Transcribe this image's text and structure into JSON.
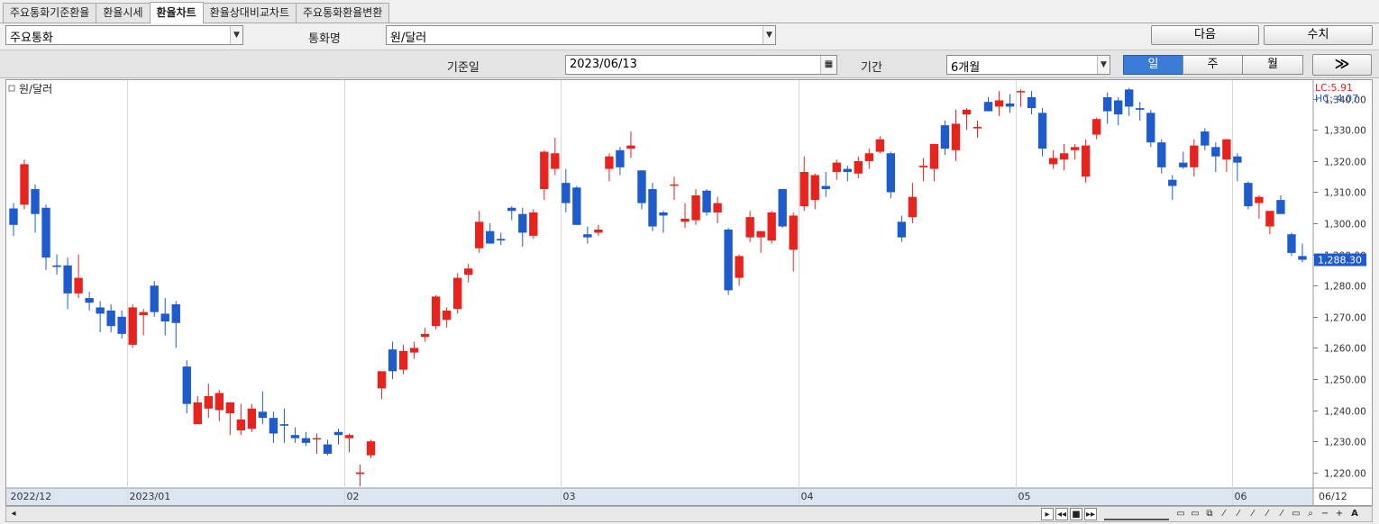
{
  "tabs": [
    {
      "label": "주요통화기준환율",
      "active": false
    },
    {
      "label": "환율시세",
      "active": false
    },
    {
      "label": "환율차트",
      "active": true
    },
    {
      "label": "환율상대비교차트",
      "active": false
    },
    {
      "label": "주요통화환율변환",
      "active": false
    }
  ],
  "controls": {
    "currency_group": "주요통화",
    "currency_name_label": "통화명",
    "currency_name": "원/달러",
    "next_label": "다음",
    "value_label": "수치",
    "base_date_label": "기준일",
    "base_date": "2023/06/13",
    "period_label": "기간",
    "period": "6개월",
    "interval_day": "일",
    "interval_week": "주",
    "interval_month": "월",
    "interval_selected": "일",
    "forward_glyph": "≫"
  },
  "colors": {
    "up": "#e8231e",
    "down": "#1e5ccd",
    "grid": "#d8d8d8",
    "axis_bg": "#dce6f2",
    "current": "#1e5ccd"
  },
  "chart_data": {
    "type": "candlestick",
    "legend": "원/달러",
    "lc": "LC:5.91",
    "hc": "HC:-4.07",
    "current_price": "1,288.30",
    "ylim": [
      1215,
      1346
    ],
    "y_ticks": [
      {
        "value": 1340,
        "label": "1,340.00"
      },
      {
        "value": 1330,
        "label": "1,330.00"
      },
      {
        "value": 1320,
        "label": "1,320.00"
      },
      {
        "value": 1310,
        "label": "1,310.00"
      },
      {
        "value": 1300,
        "label": "1,300.00"
      },
      {
        "value": 1290,
        "label": "1,290.00"
      },
      {
        "value": 1280,
        "label": "1,280.00"
      },
      {
        "value": 1270,
        "label": "1,270.00"
      },
      {
        "value": 1260,
        "label": "1,260.00"
      },
      {
        "value": 1250,
        "label": "1,250.00"
      },
      {
        "value": 1240,
        "label": "1,240.00"
      },
      {
        "value": 1230,
        "label": "1,230.00"
      },
      {
        "value": 1220,
        "label": "1,220.00"
      }
    ],
    "x_labels": [
      {
        "index": 0,
        "label": "2022/12"
      },
      {
        "index": 11,
        "label": "2023/01"
      },
      {
        "index": 31,
        "label": "02"
      },
      {
        "index": 51,
        "label": "03"
      },
      {
        "index": 73,
        "label": "04"
      },
      {
        "index": 93,
        "label": "05"
      },
      {
        "index": 113,
        "label": "06"
      },
      {
        "index": 120,
        "label": "06/12"
      }
    ],
    "candles": [
      [
        1304.8,
        1306.5,
        1296.0,
        1299.5
      ],
      [
        1306.0,
        1320.5,
        1304.5,
        1319.0
      ],
      [
        1311.0,
        1312.5,
        1297.0,
        1303.0
      ],
      [
        1305.0,
        1306.0,
        1285.0,
        1289.0
      ],
      [
        1286.5,
        1290.0,
        1283.5,
        1286.0
      ],
      [
        1286.5,
        1289.0,
        1272.5,
        1277.5
      ],
      [
        1277.5,
        1290.0,
        1276.0,
        1282.5
      ],
      [
        1276.0,
        1278.0,
        1272.0,
        1274.5
      ],
      [
        1273.0,
        1275.0,
        1265.0,
        1271.0
      ],
      [
        1272.0,
        1274.0,
        1265.0,
        1267.0
      ],
      [
        1270.0,
        1272.0,
        1263.0,
        1264.5
      ],
      [
        1261.0,
        1274.0,
        1260.0,
        1273.0
      ],
      [
        1270.5,
        1272.5,
        1264.0,
        1271.5
      ],
      [
        1280.0,
        1281.5,
        1270.0,
        1271.5
      ],
      [
        1271.0,
        1276.0,
        1264.0,
        1268.5
      ],
      [
        1274.0,
        1275.0,
        1260.0,
        1268.0
      ],
      [
        1254.0,
        1256.0,
        1239.0,
        1242.0
      ],
      [
        1235.5,
        1244.5,
        1235.5,
        1242.5
      ],
      [
        1240.5,
        1248.5,
        1237.5,
        1244.5
      ],
      [
        1240.0,
        1246.5,
        1236.5,
        1245.5
      ],
      [
        1239.0,
        1242.5,
        1232.0,
        1242.5
      ],
      [
        1233.5,
        1242.0,
        1232.0,
        1237.0
      ],
      [
        1234.0,
        1242.0,
        1233.0,
        1240.5
      ],
      [
        1239.5,
        1246.0,
        1235.5,
        1237.5
      ],
      [
        1237.5,
        1239.5,
        1229.5,
        1232.5
      ],
      [
        1235.5,
        1240.5,
        1229.5,
        1235.0
      ],
      [
        1232.0,
        1234.5,
        1229.5,
        1231.0
      ],
      [
        1231.0,
        1233.0,
        1228.5,
        1229.5
      ],
      [
        1231.0,
        1232.5,
        1226.0,
        1231.0
      ],
      [
        1229.0,
        1230.5,
        1225.5,
        1226.0
      ],
      [
        1233.0,
        1234.0,
        1229.0,
        1232.0
      ],
      [
        1231.0,
        1232.5,
        1226.5,
        1232.0
      ],
      [
        1219.5,
        1222.5,
        1215.5,
        1220.0
      ],
      [
        1225.5,
        1230.5,
        1224.5,
        1230.0
      ],
      [
        1247.0,
        1251.0,
        1243.5,
        1252.5
      ],
      [
        1259.5,
        1262.0,
        1250.0,
        1252.5
      ],
      [
        1253.0,
        1261.0,
        1251.5,
        1259.0
      ],
      [
        1258.5,
        1262.0,
        1256.5,
        1260.0
      ],
      [
        1263.5,
        1266.5,
        1262.0,
        1264.5
      ],
      [
        1267.0,
        1277.0,
        1266.0,
        1276.5
      ],
      [
        1269.0,
        1273.0,
        1266.5,
        1272.0
      ],
      [
        1272.5,
        1284.0,
        1271.0,
        1282.5
      ],
      [
        1283.5,
        1287.0,
        1281.0,
        1285.5
      ],
      [
        1292.0,
        1304.0,
        1290.5,
        1300.5
      ],
      [
        1297.5,
        1300.0,
        1293.5,
        1293.5
      ],
      [
        1295.0,
        1297.0,
        1293.0,
        1294.5
      ],
      [
        1305.0,
        1305.5,
        1301.0,
        1304.0
      ],
      [
        1303.0,
        1305.0,
        1292.5,
        1297.0
      ],
      [
        1296.0,
        1304.5,
        1295.0,
        1303.5
      ],
      [
        1311.0,
        1323.5,
        1307.5,
        1323.0
      ],
      [
        1317.5,
        1327.5,
        1315.5,
        1322.5
      ],
      [
        1313.0,
        1317.5,
        1303.5,
        1306.5
      ],
      [
        1311.5,
        1312.0,
        1300.0,
        1299.5
      ],
      [
        1296.5,
        1299.0,
        1293.5,
        1295.5
      ],
      [
        1297.0,
        1299.5,
        1296.0,
        1298.0
      ],
      [
        1317.5,
        1322.5,
        1313.5,
        1321.5
      ],
      [
        1323.5,
        1324.5,
        1315.5,
        1318.0
      ],
      [
        1324.0,
        1329.5,
        1321.0,
        1325.0
      ],
      [
        1317.0,
        1317.0,
        1304.5,
        1306.5
      ],
      [
        1311.0,
        1313.0,
        1297.5,
        1299.0
      ],
      [
        1303.5,
        1304.0,
        1297.0,
        1302.5
      ],
      [
        1312.5,
        1315.0,
        1307.5,
        1312.5
      ],
      [
        1300.5,
        1306.5,
        1298.5,
        1301.5
      ],
      [
        1301.0,
        1311.0,
        1299.5,
        1309.0
      ],
      [
        1310.5,
        1311.0,
        1302.5,
        1303.5
      ],
      [
        1303.5,
        1308.5,
        1300.0,
        1306.5
      ],
      [
        1298.0,
        1298.5,
        1277.0,
        1278.5
      ],
      [
        1282.5,
        1290.0,
        1280.0,
        1289.5
      ],
      [
        1295.5,
        1304.0,
        1294.0,
        1302.0
      ],
      [
        1295.5,
        1297.5,
        1290.5,
        1297.5
      ],
      [
        1294.5,
        1304.0,
        1293.5,
        1303.5
      ],
      [
        1311.0,
        1311.0,
        1298.5,
        1299.0
      ],
      [
        1291.5,
        1303.5,
        1284.5,
        1302.5
      ],
      [
        1305.5,
        1321.5,
        1304.0,
        1316.5
      ],
      [
        1307.5,
        1316.0,
        1304.5,
        1315.5
      ],
      [
        1312.0,
        1316.5,
        1308.5,
        1311.0
      ],
      [
        1316.5,
        1320.5,
        1314.0,
        1319.5
      ],
      [
        1317.5,
        1318.5,
        1313.5,
        1316.5
      ],
      [
        1316.0,
        1321.5,
        1314.5,
        1320.0
      ],
      [
        1320.0,
        1324.0,
        1317.5,
        1322.5
      ],
      [
        1323.0,
        1328.0,
        1322.5,
        1327.0
      ],
      [
        1322.5,
        1323.0,
        1308.0,
        1310.0
      ],
      [
        1300.5,
        1302.5,
        1294.0,
        1295.5
      ],
      [
        1302.0,
        1313.0,
        1300.0,
        1308.5
      ],
      [
        1318.0,
        1321.0,
        1313.5,
        1318.5
      ],
      [
        1317.5,
        1325.5,
        1313.5,
        1325.5
      ],
      [
        1331.5,
        1333.0,
        1322.0,
        1324.0
      ],
      [
        1323.5,
        1336.5,
        1320.0,
        1332.0
      ],
      [
        1335.0,
        1337.0,
        1330.0,
        1336.5
      ],
      [
        1330.5,
        1333.0,
        1327.5,
        1331.0
      ],
      [
        1339.0,
        1340.5,
        1336.0,
        1336.0
      ],
      [
        1337.5,
        1342.5,
        1334.5,
        1339.5
      ],
      [
        1338.5,
        1341.5,
        1335.5,
        1337.5
      ],
      [
        1342.5,
        1343.0,
        1337.5,
        1342.5
      ],
      [
        1340.5,
        1342.5,
        1335.0,
        1337.0
      ],
      [
        1335.5,
        1337.0,
        1321.5,
        1324.0
      ],
      [
        1319.0,
        1323.5,
        1317.5,
        1321.0
      ],
      [
        1320.5,
        1325.5,
        1317.0,
        1322.5
      ],
      [
        1323.5,
        1325.5,
        1320.5,
        1324.5
      ],
      [
        1315.0,
        1327.0,
        1313.0,
        1325.0
      ],
      [
        1328.5,
        1334.0,
        1327.0,
        1333.5
      ],
      [
        1340.5,
        1342.0,
        1332.0,
        1336.0
      ],
      [
        1339.5,
        1340.5,
        1331.5,
        1335.0
      ],
      [
        1343.0,
        1343.5,
        1334.5,
        1337.5
      ],
      [
        1337.0,
        1339.0,
        1333.0,
        1336.5
      ],
      [
        1335.5,
        1336.5,
        1324.5,
        1326.0
      ],
      [
        1326.0,
        1327.0,
        1316.0,
        1318.0
      ],
      [
        1314.0,
        1315.5,
        1307.5,
        1312.0
      ],
      [
        1319.5,
        1323.0,
        1317.5,
        1318.0
      ],
      [
        1318.0,
        1327.0,
        1315.0,
        1325.0
      ],
      [
        1329.5,
        1330.5,
        1323.5,
        1325.0
      ],
      [
        1324.5,
        1326.0,
        1316.5,
        1321.5
      ],
      [
        1320.5,
        1327.0,
        1316.5,
        1327.0
      ],
      [
        1321.5,
        1322.5,
        1313.5,
        1319.5
      ],
      [
        1313.0,
        1313.5,
        1304.5,
        1305.5
      ],
      [
        1306.5,
        1309.0,
        1301.5,
        1308.5
      ],
      [
        1299.0,
        1304.0,
        1296.5,
        1304.0
      ],
      [
        1307.5,
        1309.0,
        1303.0,
        1303.0
      ],
      [
        1296.5,
        1297.0,
        1289.5,
        1290.5
      ],
      [
        1289.5,
        1293.5,
        1287.5,
        1288.3
      ]
    ]
  }
}
